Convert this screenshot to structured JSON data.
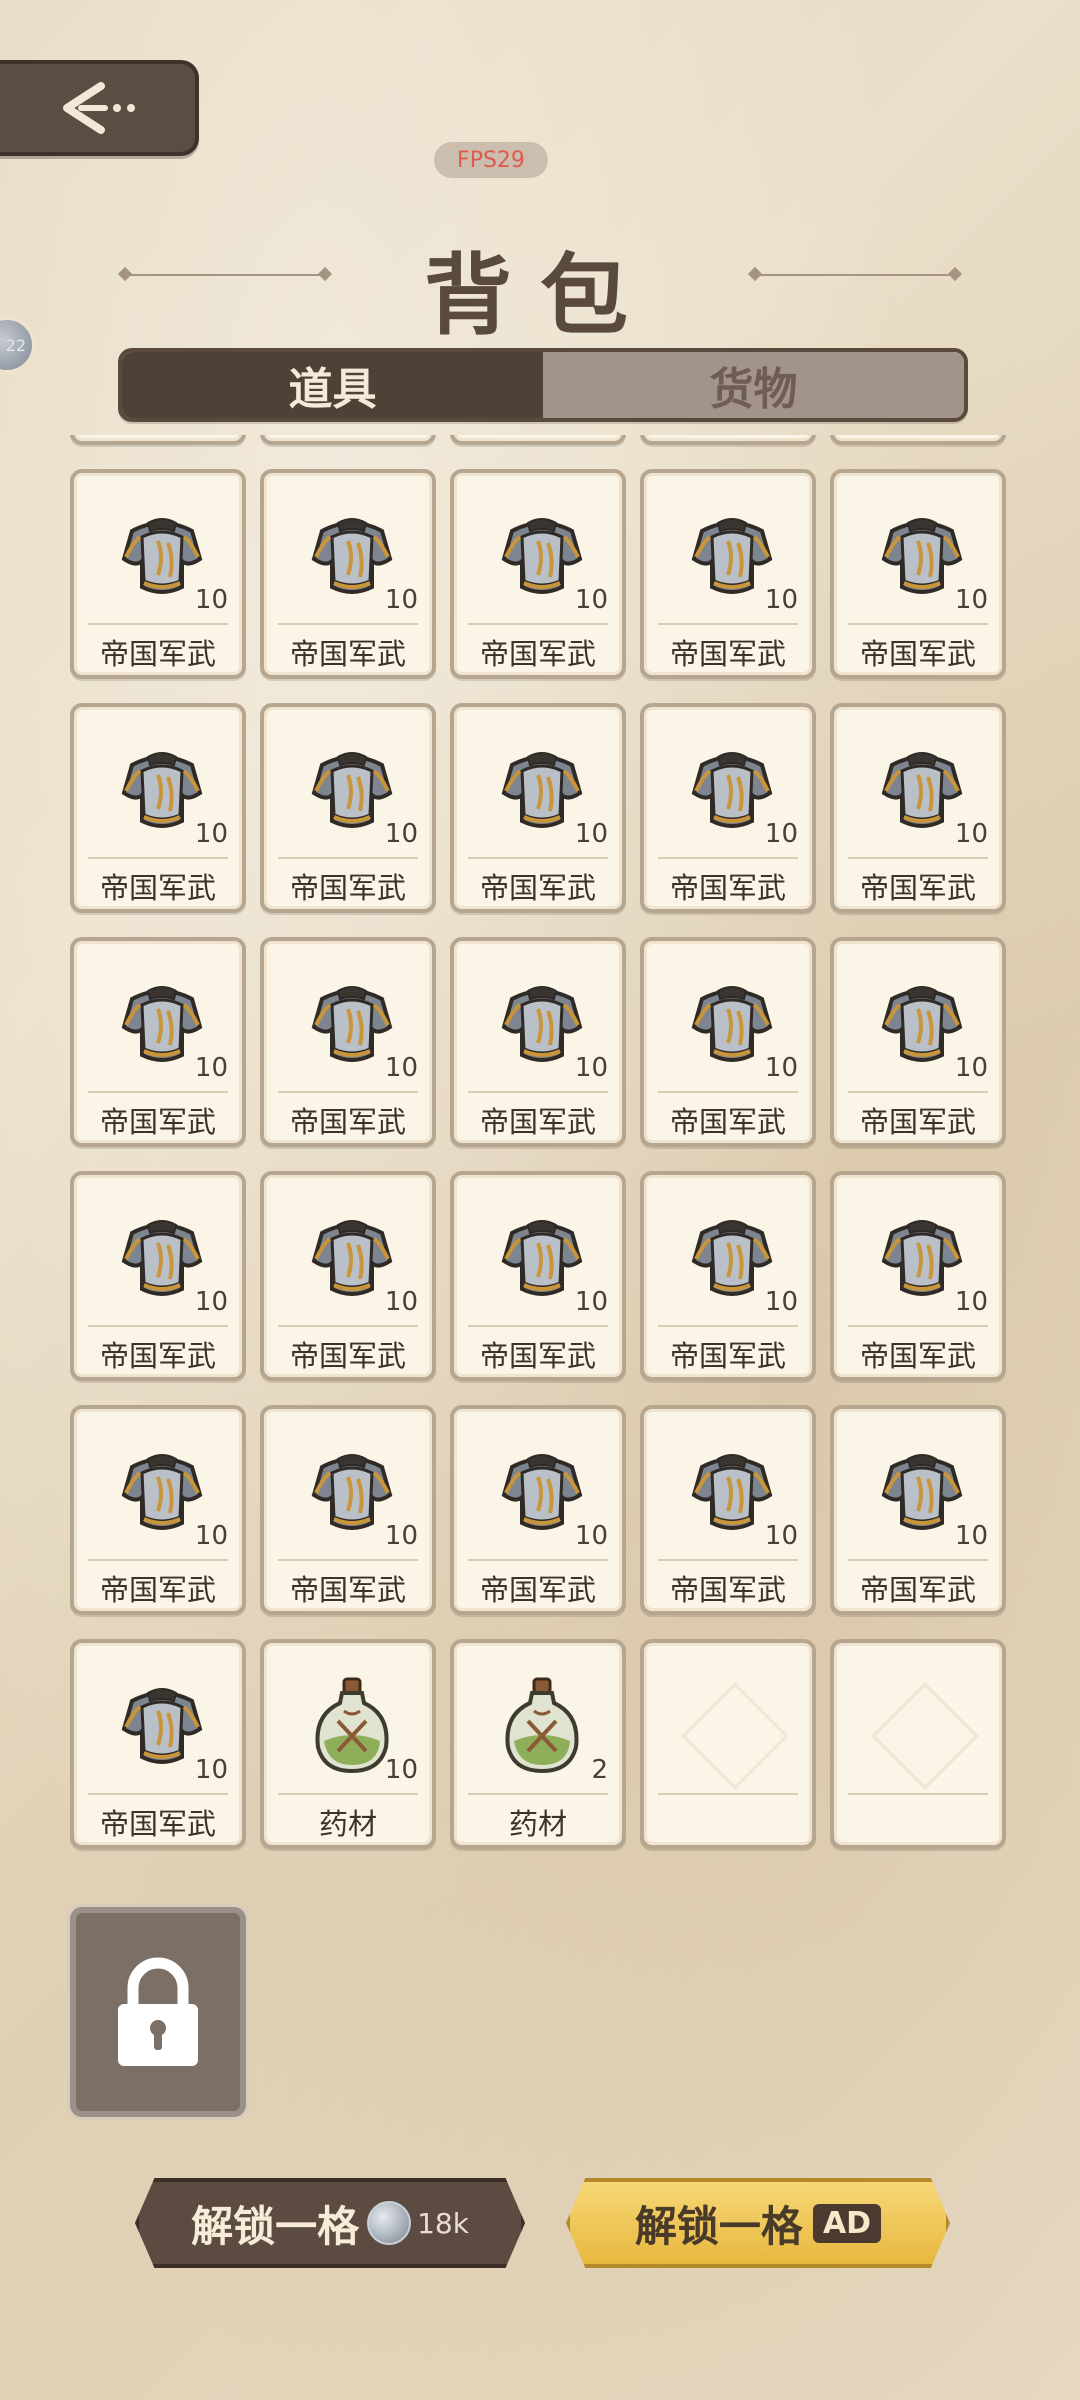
{
  "header": {
    "fps": "FPS29",
    "side_badge": "22",
    "title": "背包"
  },
  "tabs": [
    {
      "label": "道具",
      "active": true
    },
    {
      "label": "货物",
      "active": false
    }
  ],
  "items": [
    {
      "name": "帝国军武",
      "count": "",
      "type": "armor"
    },
    {
      "name": "帝国军武",
      "count": "",
      "type": "armor"
    },
    {
      "name": "帝国军武",
      "count": "",
      "type": "armor"
    },
    {
      "name": "帝国军武",
      "count": "",
      "type": "armor"
    },
    {
      "name": "帝国军武",
      "count": "",
      "type": "armor"
    },
    {
      "name": "帝国军武",
      "count": "10",
      "type": "armor"
    },
    {
      "name": "帝国军武",
      "count": "10",
      "type": "armor"
    },
    {
      "name": "帝国军武",
      "count": "10",
      "type": "armor"
    },
    {
      "name": "帝国军武",
      "count": "10",
      "type": "armor"
    },
    {
      "name": "帝国军武",
      "count": "10",
      "type": "armor"
    },
    {
      "name": "帝国军武",
      "count": "10",
      "type": "armor"
    },
    {
      "name": "帝国军武",
      "count": "10",
      "type": "armor"
    },
    {
      "name": "帝国军武",
      "count": "10",
      "type": "armor"
    },
    {
      "name": "帝国军武",
      "count": "10",
      "type": "armor"
    },
    {
      "name": "帝国军武",
      "count": "10",
      "type": "armor"
    },
    {
      "name": "帝国军武",
      "count": "10",
      "type": "armor"
    },
    {
      "name": "帝国军武",
      "count": "10",
      "type": "armor"
    },
    {
      "name": "帝国军武",
      "count": "10",
      "type": "armor"
    },
    {
      "name": "帝国军武",
      "count": "10",
      "type": "armor"
    },
    {
      "name": "帝国军武",
      "count": "10",
      "type": "armor"
    },
    {
      "name": "帝国军武",
      "count": "10",
      "type": "armor"
    },
    {
      "name": "帝国军武",
      "count": "10",
      "type": "armor"
    },
    {
      "name": "帝国军武",
      "count": "10",
      "type": "armor"
    },
    {
      "name": "帝国军武",
      "count": "10",
      "type": "armor"
    },
    {
      "name": "帝国军武",
      "count": "10",
      "type": "armor"
    },
    {
      "name": "帝国军武",
      "count": "10",
      "type": "armor"
    },
    {
      "name": "帝国军武",
      "count": "10",
      "type": "armor"
    },
    {
      "name": "帝国军武",
      "count": "10",
      "type": "armor"
    },
    {
      "name": "帝国军武",
      "count": "10",
      "type": "armor"
    },
    {
      "name": "帝国军武",
      "count": "10",
      "type": "armor"
    },
    {
      "name": "帝国军武",
      "count": "10",
      "type": "armor"
    },
    {
      "name": "药材",
      "count": "10",
      "type": "herb"
    },
    {
      "name": "药材",
      "count": "2",
      "type": "herb"
    },
    {
      "name": "",
      "count": "",
      "type": "empty"
    },
    {
      "name": "",
      "count": "",
      "type": "empty"
    }
  ],
  "icons": {
    "back": "back-arrow-icon",
    "lock": "lock-icon",
    "armor": "armor-icon",
    "herb": "herb-bottle-icon",
    "coin": "silver-coin-icon"
  },
  "buttons": {
    "unlock_coin_label": "解锁一格",
    "unlock_coin_amount": "18k",
    "unlock_ad_label": "解锁一格",
    "unlock_ad_badge": "AD"
  },
  "colors": {
    "parchment": "#e6d8bf",
    "dark_brown": "#4f4136",
    "gold": "#e7b83f",
    "fps_red": "#e05a4c"
  }
}
